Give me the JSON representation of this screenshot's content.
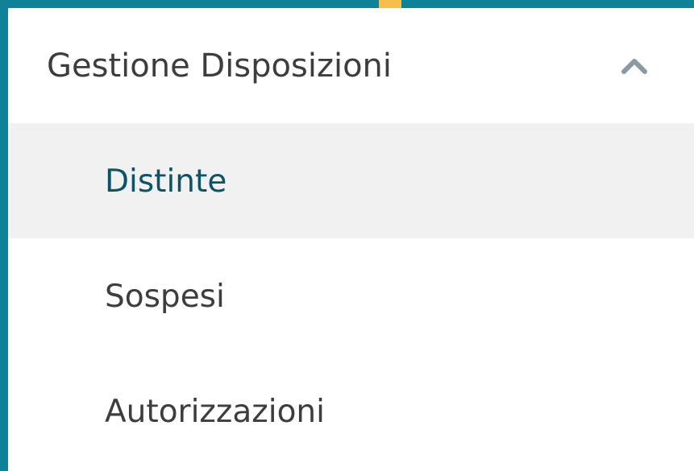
{
  "menu": {
    "title": "Gestione Disposizioni",
    "expanded_icon": "chevron-up-icon",
    "items": [
      {
        "label": "Distinte",
        "active": true
      },
      {
        "label": "Sospesi",
        "active": false
      },
      {
        "label": "Autorizzazioni",
        "active": false
      }
    ]
  },
  "colors": {
    "frame": "#0f8298",
    "accent": "#f6bf4c",
    "active_background": "#f1f1f1",
    "active_text": "#0c5368",
    "text": "#3d3d3d",
    "icon": "#8a9aa2"
  }
}
